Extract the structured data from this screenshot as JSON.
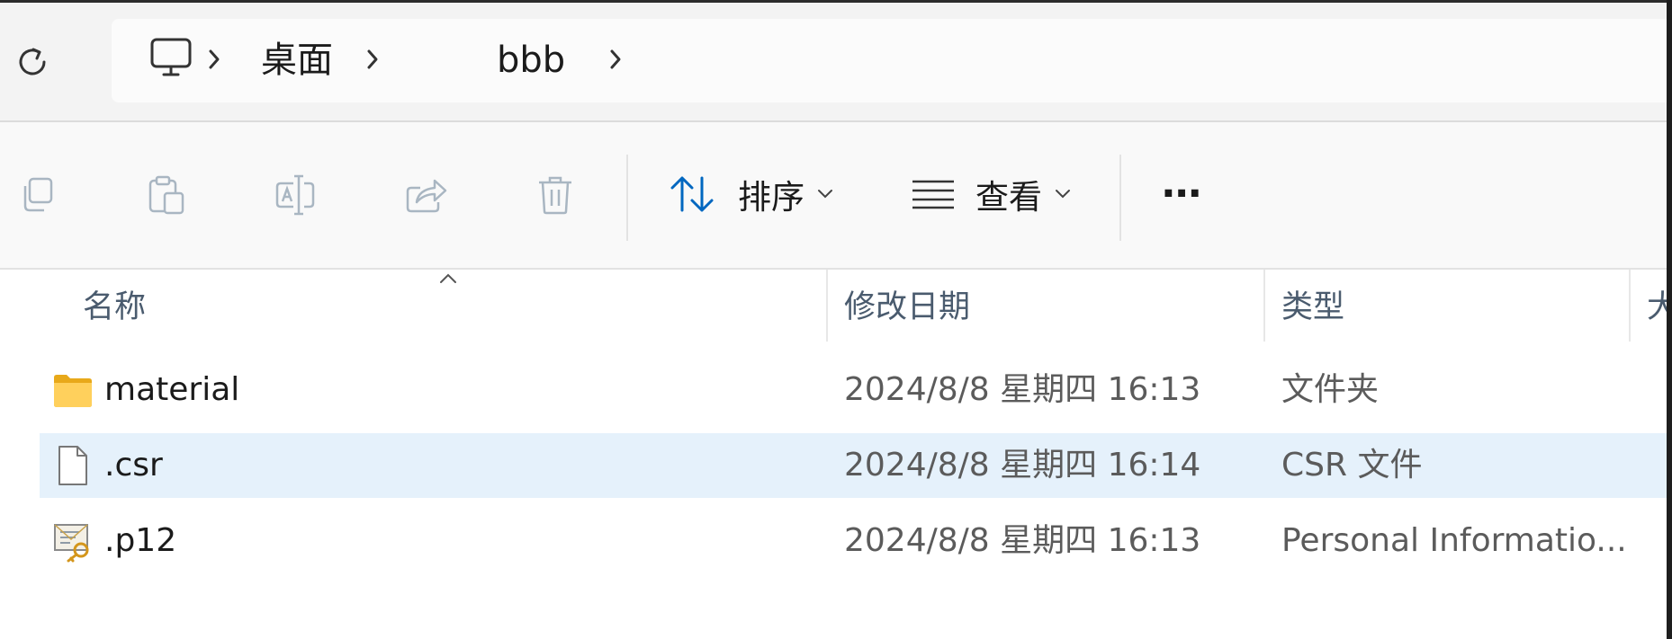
{
  "breadcrumb": {
    "items": [
      "桌面",
      "bbb"
    ]
  },
  "toolbar": {
    "sort_label": "排序",
    "view_label": "查看",
    "more_label": "···"
  },
  "columns": {
    "name": "名称",
    "modified": "修改日期",
    "type": "类型",
    "size_partial": "大"
  },
  "files": [
    {
      "name": "material",
      "modified": "2024/8/8 星期四 16:13",
      "type": "文件夹",
      "icon": "folder-icon",
      "selected": false
    },
    {
      "name": ".csr",
      "modified": "2024/8/8 星期四 16:14",
      "type": "CSR 文件",
      "icon": "file-icon",
      "selected": true
    },
    {
      "name": ".p12",
      "modified": "2024/8/8 星期四 16:13",
      "type": "Personal Informatio...",
      "icon": "certificate-icon",
      "selected": false
    }
  ],
  "colors": {
    "accent": "#0067c0",
    "selection": "#e5f1fb",
    "header_text": "#4a5b6e"
  }
}
